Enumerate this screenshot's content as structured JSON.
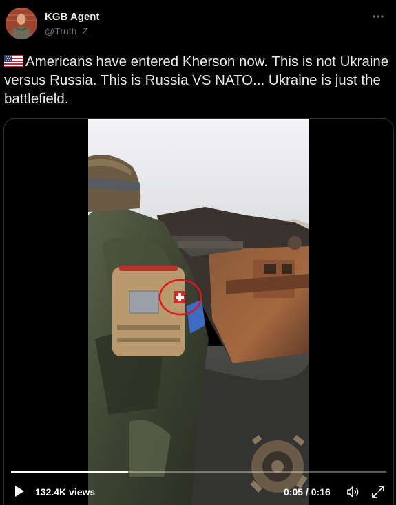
{
  "author": {
    "display_name": "KGB Agent",
    "handle": "@Truth_Z_"
  },
  "icons": {
    "more": "more-horizontal-icon",
    "flag": "us-flag-icon",
    "play": "play-icon",
    "volume": "volume-icon",
    "fullscreen": "fullscreen-icon"
  },
  "tweet": {
    "text": "Americans have entered Kherson now. This is not Ukraine versus Russia. This is Russia VS NATO... Ukraine is just the battlefield."
  },
  "video": {
    "views": "132.4K views",
    "time": "0:05 / 0:16",
    "progress": 0.3125
  },
  "colors": {
    "background": "#000000",
    "text": "#e7e9ea",
    "muted": "#71767b",
    "border": "#2f3336",
    "annotation_circle": "#e0141a"
  }
}
